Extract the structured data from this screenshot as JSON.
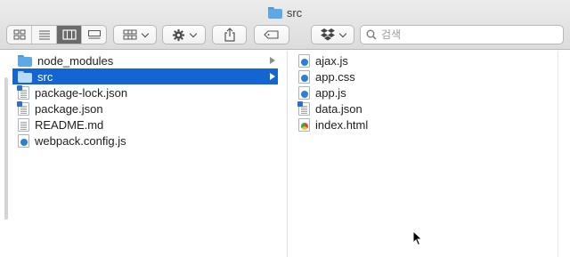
{
  "window": {
    "title": "src"
  },
  "toolbar": {
    "search_placeholder": "검색",
    "view_buttons": [
      "icon-view-icon",
      "list-view-icon",
      "column-view-icon",
      "gallery-view-icon"
    ],
    "active_view": "column"
  },
  "colors": {
    "folder": "#5fa8e6",
    "folder_tab": "#4d97da",
    "selection": "#1464d2",
    "js_icon": "#2f7fd0",
    "chrome_icon_red": "#de4a3a"
  },
  "column1": {
    "items": [
      {
        "name": "node_modules",
        "kind": "folder",
        "has_children": true,
        "selected": false
      },
      {
        "name": "src",
        "kind": "folder",
        "has_children": true,
        "selected": true
      },
      {
        "name": "package-lock.json",
        "kind": "json",
        "selected": false
      },
      {
        "name": "package.json",
        "kind": "json",
        "selected": false
      },
      {
        "name": "README.md",
        "kind": "text",
        "selected": false
      },
      {
        "name": "webpack.config.js",
        "kind": "js",
        "selected": false
      }
    ]
  },
  "column2": {
    "items": [
      {
        "name": "ajax.js",
        "kind": "js"
      },
      {
        "name": "app.css",
        "kind": "css"
      },
      {
        "name": "app.js",
        "kind": "js"
      },
      {
        "name": "data.json",
        "kind": "json"
      },
      {
        "name": "index.html",
        "kind": "html"
      }
    ]
  }
}
